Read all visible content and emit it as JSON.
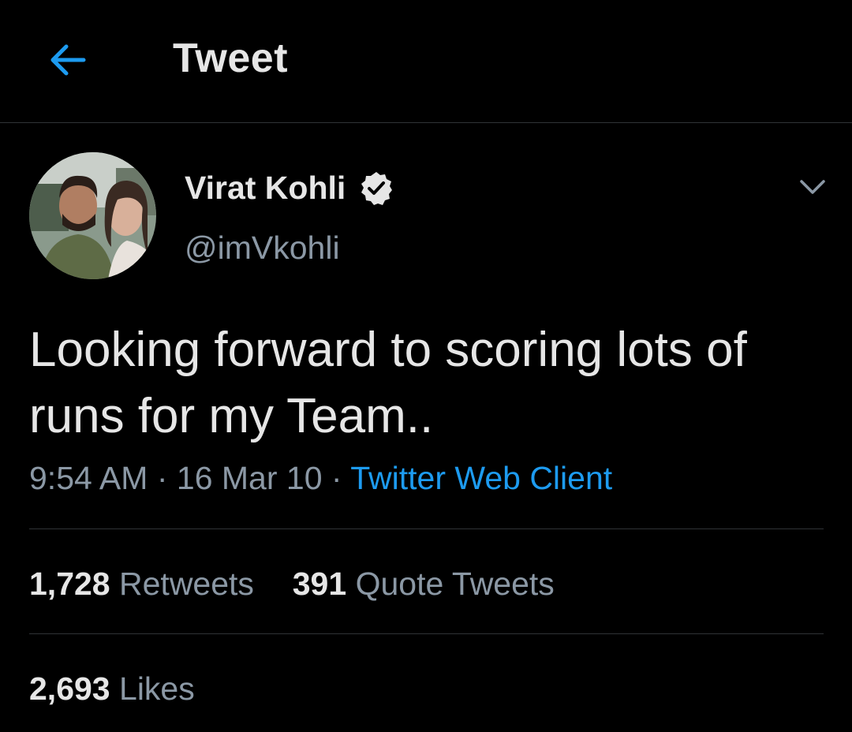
{
  "header": {
    "title": "Tweet",
    "back_icon": "arrow-left-icon",
    "accent_color": "#1d9bf0"
  },
  "tweet": {
    "author_name": "Virat Kohli",
    "verified_icon": "verified-badge-icon",
    "handle": "@imVkohli",
    "more_icon": "chevron-down-icon",
    "text": "Looking forward to scoring lots of runs for my Team..",
    "time": "9:54 AM",
    "separator": "·",
    "date": "16 Mar 10",
    "source": "Twitter Web Client"
  },
  "stats": {
    "retweets_count": "1,728",
    "retweets_label": "Retweets",
    "quotes_count": "391",
    "quotes_label": "Quote Tweets",
    "likes_count": "2,693",
    "likes_label": "Likes"
  }
}
